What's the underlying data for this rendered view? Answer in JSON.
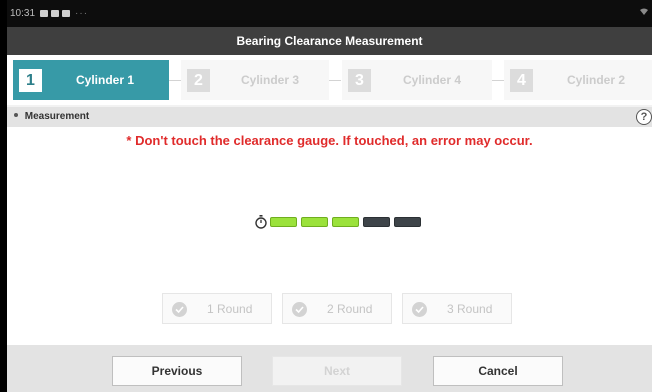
{
  "status_bar": {
    "time": "10:31",
    "overflow_dots": "···"
  },
  "title": "Bearing Clearance Measurement",
  "steps": [
    {
      "number": "1",
      "label": "Cylinder 1",
      "active": true
    },
    {
      "number": "2",
      "label": "Cylinder 3",
      "active": false
    },
    {
      "number": "3",
      "label": "Cylinder 4",
      "active": false
    },
    {
      "number": "4",
      "label": "Cylinder 2",
      "active": false
    }
  ],
  "section": {
    "title": "Measurement",
    "help_icon": "?"
  },
  "warning": "* Don't touch the clearance gauge. If touched, an error may occur.",
  "gauge": {
    "icon": "stopwatch-icon",
    "segments_total": 5,
    "segments_filled": 3,
    "filled_color": "#9be23b",
    "empty_color": "#3e4449"
  },
  "rounds": [
    {
      "label": "1 Round"
    },
    {
      "label": "2 Round"
    },
    {
      "label": "3 Round"
    }
  ],
  "buttons": {
    "previous": "Previous",
    "next": "Next",
    "cancel": "Cancel"
  },
  "colors": {
    "accent": "#379aa7",
    "warning": "#e02b2b",
    "titlebar": "#3f3f3f"
  }
}
